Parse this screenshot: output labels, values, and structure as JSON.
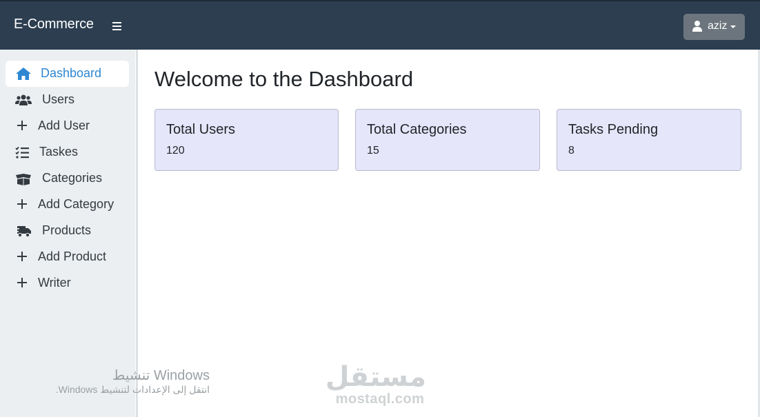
{
  "header": {
    "brand": "E-Commerce",
    "user": {
      "name": "aziz"
    }
  },
  "sidebar": {
    "items": [
      {
        "label": "Dashboard",
        "icon": "home-icon",
        "active": true
      },
      {
        "label": "Users",
        "icon": "users-icon"
      },
      {
        "label": "Add User",
        "icon": "plus-icon"
      },
      {
        "label": "Taskes",
        "icon": "task-list-icon"
      },
      {
        "label": "Categories",
        "icon": "box-open-icon"
      },
      {
        "label": "Add Category",
        "icon": "plus-icon"
      },
      {
        "label": "Products",
        "icon": "truck-icon"
      },
      {
        "label": "Add Product",
        "icon": "plus-icon"
      },
      {
        "label": "Writer",
        "icon": "plus-icon"
      }
    ]
  },
  "main": {
    "title": "Welcome to the Dashboard",
    "cards": [
      {
        "title": "Total Users",
        "value": "120"
      },
      {
        "title": "Total Categories",
        "value": "15"
      },
      {
        "title": "Tasks Pending",
        "value": "8"
      }
    ]
  },
  "watermarks": {
    "activate_title": "تنشيط Windows",
    "activate_sub": "انتقل إلى الإعدادات لتنشيط Windows.",
    "logo_ar": "مستقل",
    "logo_en": "mostaql.com"
  },
  "colors": {
    "topbar": "#2c3e50",
    "sidebar": "#eceff1",
    "active_link": "#2d87d2",
    "card_bg": "#e6e6fa",
    "user_button": "#6c757d"
  }
}
